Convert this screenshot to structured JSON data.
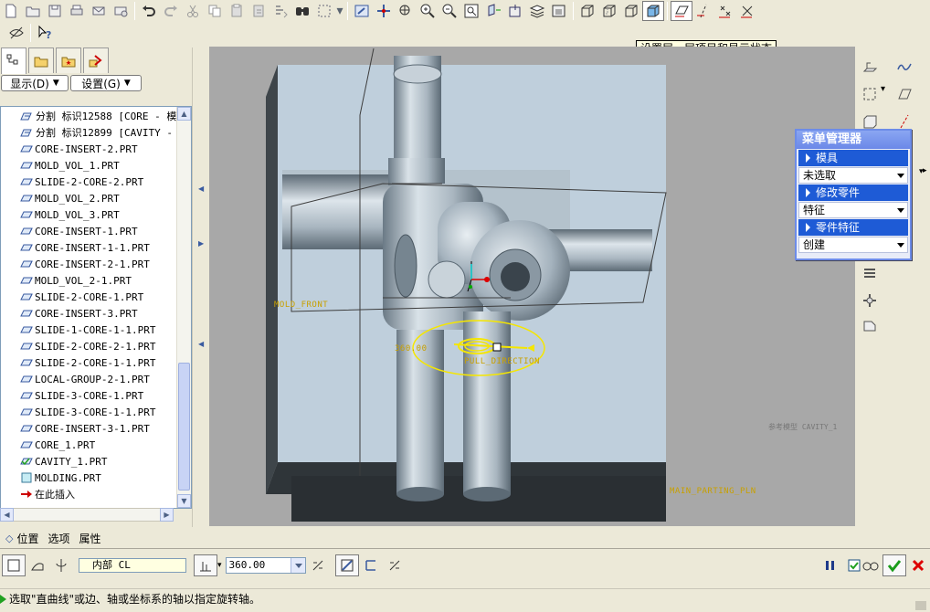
{
  "tooltip": "设置层、层项目和显示状态",
  "left_panel": {
    "show_dropdown": "显示(D)",
    "settings_dropdown": "设置(G)",
    "tree_items": [
      {
        "label": "分割 标识12588 [CORE - 模具",
        "icon": "split-feature-icon"
      },
      {
        "label": "分割 标识12899 [CAVITY - 模",
        "icon": "split-feature-icon"
      },
      {
        "label": "CORE-INSERT-2.PRT",
        "icon": "part-icon"
      },
      {
        "label": "MOLD_VOL_1.PRT",
        "icon": "part-icon"
      },
      {
        "label": "SLIDE-2-CORE-2.PRT",
        "icon": "part-icon"
      },
      {
        "label": "MOLD_VOL_2.PRT",
        "icon": "part-icon"
      },
      {
        "label": "MOLD_VOL_3.PRT",
        "icon": "part-icon"
      },
      {
        "label": "CORE-INSERT-1.PRT",
        "icon": "part-icon"
      },
      {
        "label": "CORE-INSERT-1-1.PRT",
        "icon": "part-icon"
      },
      {
        "label": "CORE-INSERT-2-1.PRT",
        "icon": "part-icon"
      },
      {
        "label": "MOLD_VOL_2-1.PRT",
        "icon": "part-icon"
      },
      {
        "label": "SLIDE-2-CORE-1.PRT",
        "icon": "part-icon"
      },
      {
        "label": "CORE-INSERT-3.PRT",
        "icon": "part-icon"
      },
      {
        "label": "SLIDE-1-CORE-1-1.PRT",
        "icon": "part-icon"
      },
      {
        "label": "SLIDE-2-CORE-2-1.PRT",
        "icon": "part-icon"
      },
      {
        "label": "SLIDE-2-CORE-1-1.PRT",
        "icon": "part-icon"
      },
      {
        "label": "LOCAL-GROUP-2-1.PRT",
        "icon": "part-icon"
      },
      {
        "label": "SLIDE-3-CORE-1.PRT",
        "icon": "part-icon"
      },
      {
        "label": "SLIDE-3-CORE-1-1.PRT",
        "icon": "part-icon"
      },
      {
        "label": "CORE-INSERT-3-1.PRT",
        "icon": "part-icon"
      },
      {
        "label": "CORE_1.PRT",
        "icon": "part-icon"
      },
      {
        "label": "CAVITY_1.PRT",
        "icon": "cavity-part-icon"
      },
      {
        "label": "MOLDING.PRT",
        "icon": "molding-icon"
      },
      {
        "label": "在此插入",
        "icon": "insert-here-arrow-icon"
      }
    ]
  },
  "viewport": {
    "labels": {
      "mold_front": "MOLD_FRONT",
      "angle": "360.00",
      "pull_direction": "PULL_DIRECTION",
      "cavity": "参考模型 CAVITY_1",
      "main_parting": "MAIN_PARTING_PLN"
    }
  },
  "menu_manager": {
    "title": "菜单管理器",
    "sections": [
      {
        "header": "模具",
        "value": "未选取"
      },
      {
        "header": "修改零件",
        "value": "特征"
      },
      {
        "header": "零件特征",
        "value": "创建"
      }
    ]
  },
  "dashboard": {
    "tabs": [
      "位置",
      "选项",
      "属性"
    ],
    "axis_reference": "内部 CL",
    "angle_value": "360.00"
  },
  "status_message": "选取\"直曲线\"或边、轴或坐标系的轴以指定旋转轴。"
}
